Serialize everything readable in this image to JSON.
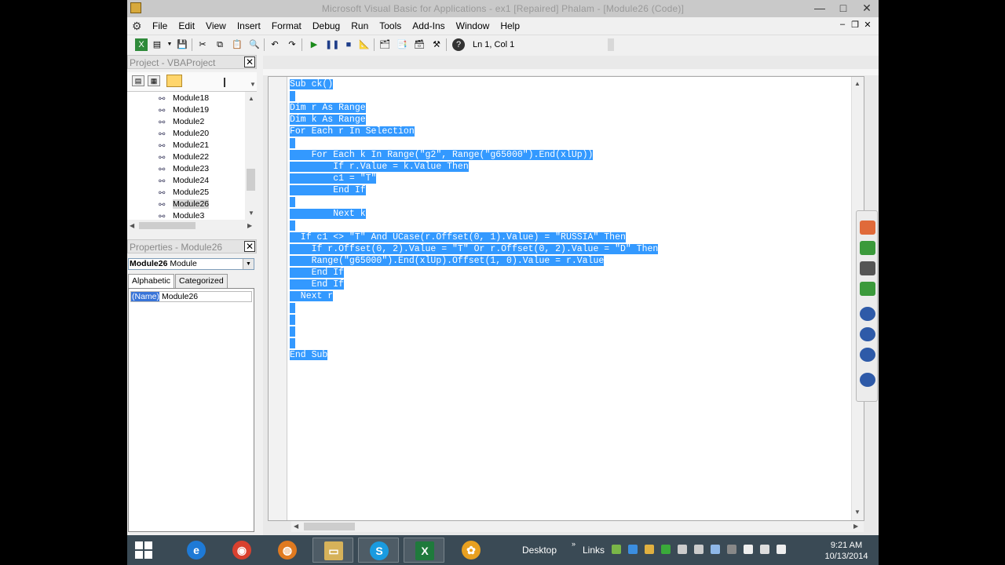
{
  "window": {
    "title": "Microsoft Visual Basic for Applications - ex1 [Repaired] Phalam - [Module26 (Code)]",
    "min": "—",
    "max": "□",
    "close": "✕"
  },
  "menu": {
    "items": [
      "File",
      "Edit",
      "View",
      "Insert",
      "Format",
      "Debug",
      "Run",
      "Tools",
      "Add-Ins",
      "Window",
      "Help"
    ],
    "mdi_min": "–",
    "mdi_restore": "❐",
    "mdi_close": "✕"
  },
  "toolbar": {
    "position": "Ln 1, Col 1"
  },
  "project": {
    "title": "Project - VBAProject",
    "modules": [
      "Module18",
      "Module19",
      "Module2",
      "Module20",
      "Module21",
      "Module22",
      "Module23",
      "Module24",
      "Module25",
      "Module26",
      "Module3"
    ],
    "selected": "Module26"
  },
  "properties": {
    "title": "Properties - Module26",
    "object_name": "Module26",
    "object_type": "Module",
    "tabs": [
      "Alphabetic",
      "Categorized"
    ],
    "rows": [
      {
        "name": "(Name)",
        "value": "Module26"
      }
    ]
  },
  "code": {
    "lines": [
      "Sub ck()",
      "",
      "Dim r As Range",
      "Dim k As Range",
      "For Each r In Selection",
      "",
      "    For Each k In Range(\"g2\", Range(\"g65000\").End(xlUp))",
      "        If r.Value = k.Value Then",
      "        c1 = \"T\"",
      "        End If",
      "",
      "        Next k",
      "",
      "  If c1 <> \"T\" And UCase(r.Offset(0, 1).Value) = \"RUSSIA\" Then",
      "    If r.Offset(0, 2).Value = \"T\" Or r.Offset(0, 2).Value = \"D\" Then",
      "    Range(\"g65000\").End(xlUp).Offset(1, 0).Value = r.Value",
      "    End If",
      "    End If",
      "  Next r",
      "",
      "",
      "",
      "",
      "End Sub"
    ]
  },
  "taskbar": {
    "desktop_label": "Desktop",
    "links_label": "Links",
    "time": "9:21 AM",
    "date": "10/13/2014"
  },
  "colors": {
    "selection": "#3399ff",
    "property_highlight": "#3874d8",
    "taskbar": "#3a4a55"
  }
}
